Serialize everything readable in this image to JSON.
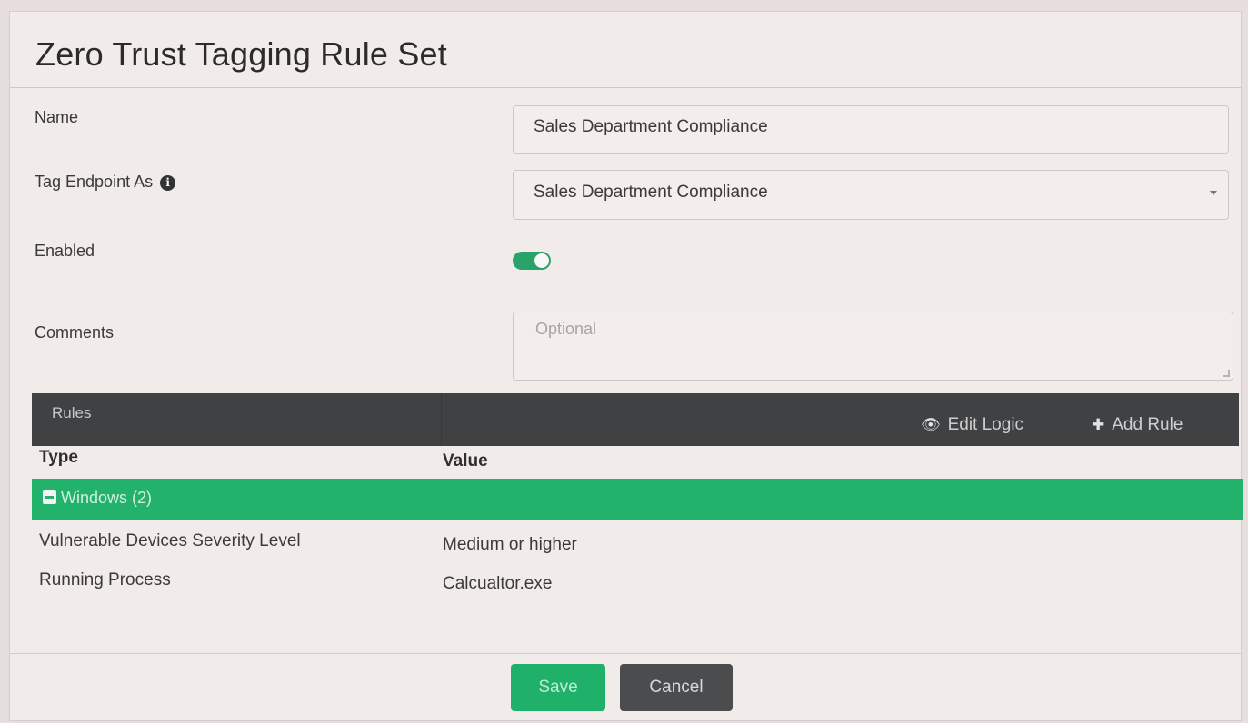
{
  "dialog": {
    "title": "Zero Trust Tagging Rule Set"
  },
  "form": {
    "name_label": "Name",
    "name_value": "Sales Department Compliance",
    "tag_label": "Tag Endpoint As",
    "tag_info_icon": "i",
    "tag_value": "Sales Department Compliance",
    "enabled_label": "Enabled",
    "enabled": true,
    "comments_label": "Comments",
    "comments_placeholder": "Optional"
  },
  "rules": {
    "title": "Rules",
    "edit_logic_label": "Edit Logic",
    "add_rule_label": "Add Rule",
    "columns": [
      "Type",
      "Value"
    ],
    "group_label": "Windows (2)",
    "rows": [
      {
        "type": "Vulnerable Devices Severity Level",
        "value": "Medium or higher"
      },
      {
        "type": "Running Process",
        "value": "Calcualtor.exe"
      }
    ]
  },
  "footer": {
    "save_label": "Save",
    "cancel_label": "Cancel"
  },
  "colors": {
    "accent_green": "#23b26b",
    "dark_bar": "#3f4143"
  }
}
